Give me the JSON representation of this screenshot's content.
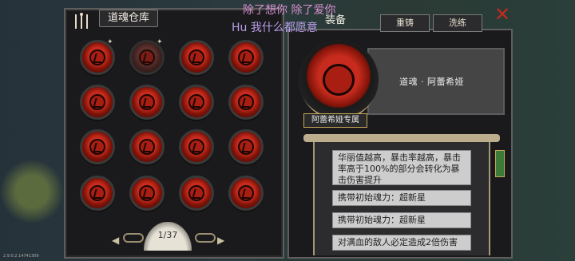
{
  "left": {
    "title": "道魂仓库",
    "page": "1/37",
    "prev": "◀",
    "next": "▶"
  },
  "right": {
    "tab_equip": "装备",
    "tab_recast": "重铸",
    "tab_wash": "洗练",
    "item_name": "道魂 · 阿蕾希娅",
    "tag": "阿蕾希娅专属",
    "desc": "华丽值越高，暴击率越高，暴击率高于100%的部分会转化为暴击伤害提升",
    "line1": "携带初始魂力：超新星",
    "line2": "携带初始魂力：超新星",
    "line3": "对满血的敌人必定造成2倍伤害"
  },
  "overlay": {
    "line1": "除了想你 除了爱你",
    "line2": "Hu 我什么都愿意"
  },
  "close_glyph": "✕",
  "version": "2.9.0.2.14741309"
}
